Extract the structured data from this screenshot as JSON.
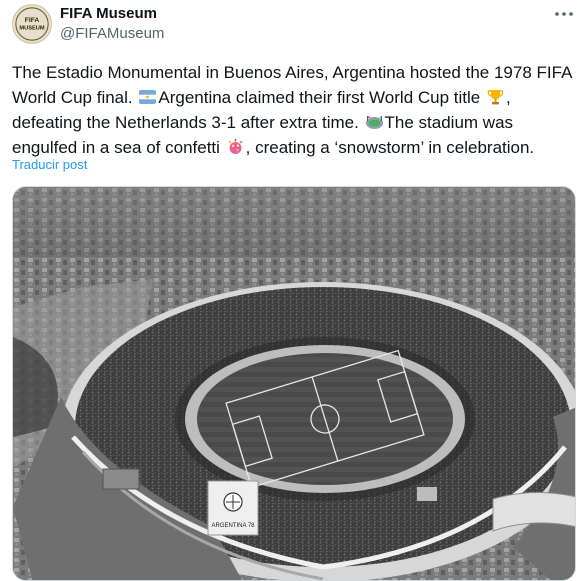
{
  "author": {
    "display_name": "FIFA Museum",
    "handle": "@FIFAMuseum",
    "avatar_text": "FIFA MUSEUM"
  },
  "post": {
    "segments": [
      "The Estadio Monumental in Buenos Aires, Argentina hosted the 1978 FIFA World Cup final. ",
      "Argentina claimed their first World Cup title ",
      ", defeating the Netherlands 3-1 after extra time. ",
      "The stadium was engulfed in a sea of confetti ",
      ", creating a ‘snowstorm’ in celebration."
    ],
    "emojis": [
      "argentina-flag-icon",
      "trophy-icon",
      "stadium-icon",
      "confetti-icon"
    ]
  },
  "translate_label": "Traducir post",
  "media": {
    "type": "photo",
    "description_icon": "stadium-photo",
    "logo_text": "ARGENTINA 78"
  },
  "colors": {
    "link": "#1d9bf0",
    "secondary_text": "#536471",
    "primary_text": "#0f1419"
  }
}
